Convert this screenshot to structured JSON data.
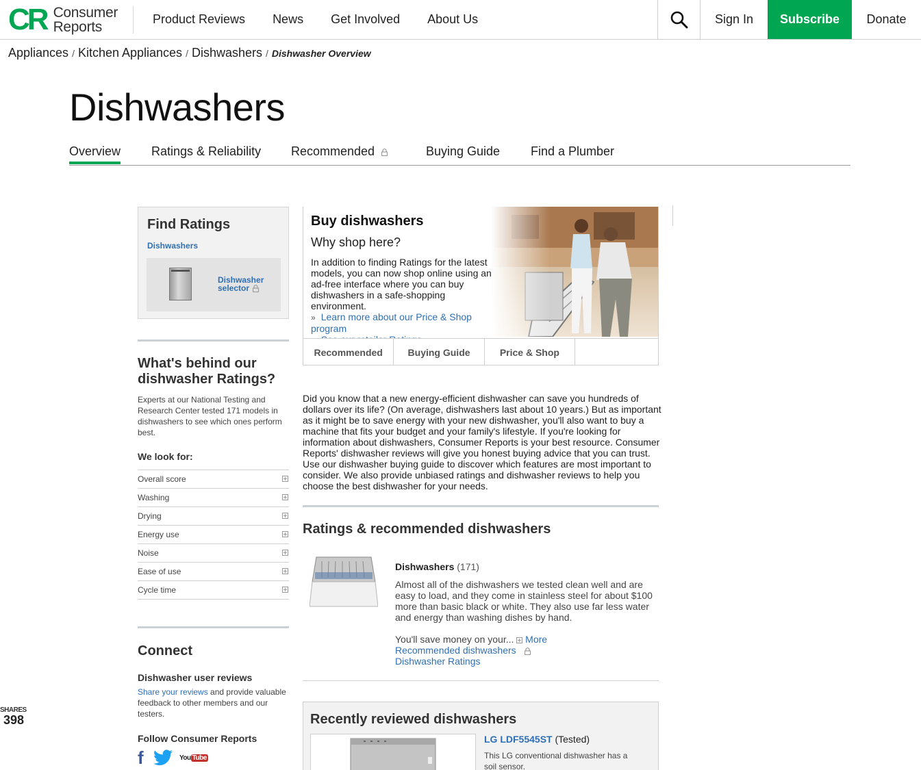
{
  "header": {
    "logo_mark": "CR",
    "logo_line1": "Consumer",
    "logo_line2": "Reports",
    "nav": [
      "Product Reviews",
      "News",
      "Get Involved",
      "About Us"
    ],
    "sign_in": "Sign In",
    "subscribe": "Subscribe",
    "donate": "Donate",
    "accent_color": "#00a651"
  },
  "breadcrumb": {
    "items": [
      "Appliances",
      "Kitchen Appliances",
      "Dishwashers"
    ],
    "separator": "/",
    "current": "Dishwasher Overview"
  },
  "page": {
    "title": "Dishwashers",
    "tabs": [
      "Overview",
      "Ratings & Reliability",
      "Recommended",
      "Buying Guide",
      "Find a Plumber"
    ],
    "active_tab": "Overview"
  },
  "find_ratings": {
    "title": "Find Ratings",
    "category_link": "Dishwashers",
    "selector_line1": "Dishwasher",
    "selector_line2": "selector"
  },
  "behind": {
    "title": "What's behind our dishwasher Ratings?",
    "text": "Experts at our National Testing and Research Center tested 171 models in dishwashers to see which ones perform best.",
    "look_for_title": "We look for:",
    "criteria": [
      "Overall score",
      "Washing",
      "Drying",
      "Energy use",
      "Noise",
      "Ease of use",
      "Cycle time"
    ]
  },
  "connect": {
    "title": "Connect",
    "user_reviews_title": "Dishwasher user reviews",
    "share_link": "Share your reviews",
    "share_text": " and provide valuable feedback to other members and our testers.",
    "follow_title": "Follow Consumer Reports",
    "youtube_left": "You",
    "youtube_right": "Tube"
  },
  "shares": {
    "label": "SHARES",
    "count": "398"
  },
  "buy": {
    "title": "Buy dishwashers",
    "subtitle": "Why shop here?",
    "text": "In addition to finding Ratings for the latest models, you can now shop online using an ad-free interface where you can buy dishwashers in a safe-shopping environment.",
    "link1": "Learn more about our Price & Shop program",
    "link2": "See our retailer Ratings",
    "arrow": "»",
    "subtabs": [
      "Recommended",
      "Buying Guide",
      "Price & Shop"
    ]
  },
  "intro": "Did you know that a new energy-efficient dishwasher can save you hundreds of dollars over its life? (On average, dishwashers last about 10 years.) But as important as it might be to save energy with your new dishwasher, you'll also want to buy a machine that fits your budget and your family's lifestyle. If you're looking for information about dishwashers, Consumer Reports is your best resource. Consumer Reports' dishwasher reviews will give you honest buying advice that you can trust. Use our dishwasher buying guide to discover which features are most important to consider. We also provide unbiased ratings and dishwasher reviews to help you choose the best dishwasher for your needs.",
  "ratings": {
    "title": "Ratings & recommended dishwashers",
    "product_name": "Dishwashers",
    "product_count": "(171)",
    "description": "Almost all of the dishwashers we tested clean well and are easy to load, and they come in stainless steel for about $100 more than basic black or white. They also use far less water and energy than washing dishes by hand.",
    "more_text": "You'll save money on your...",
    "more_link": "More",
    "link_recommended": "Recommended dishwashers",
    "link_ratings": "Dishwasher Ratings"
  },
  "recent": {
    "title": "Recently reviewed dishwashers",
    "model": "LG LDF5545ST",
    "status": "(Tested)",
    "description": "This LG conventional dishwasher has a soil sensor."
  }
}
